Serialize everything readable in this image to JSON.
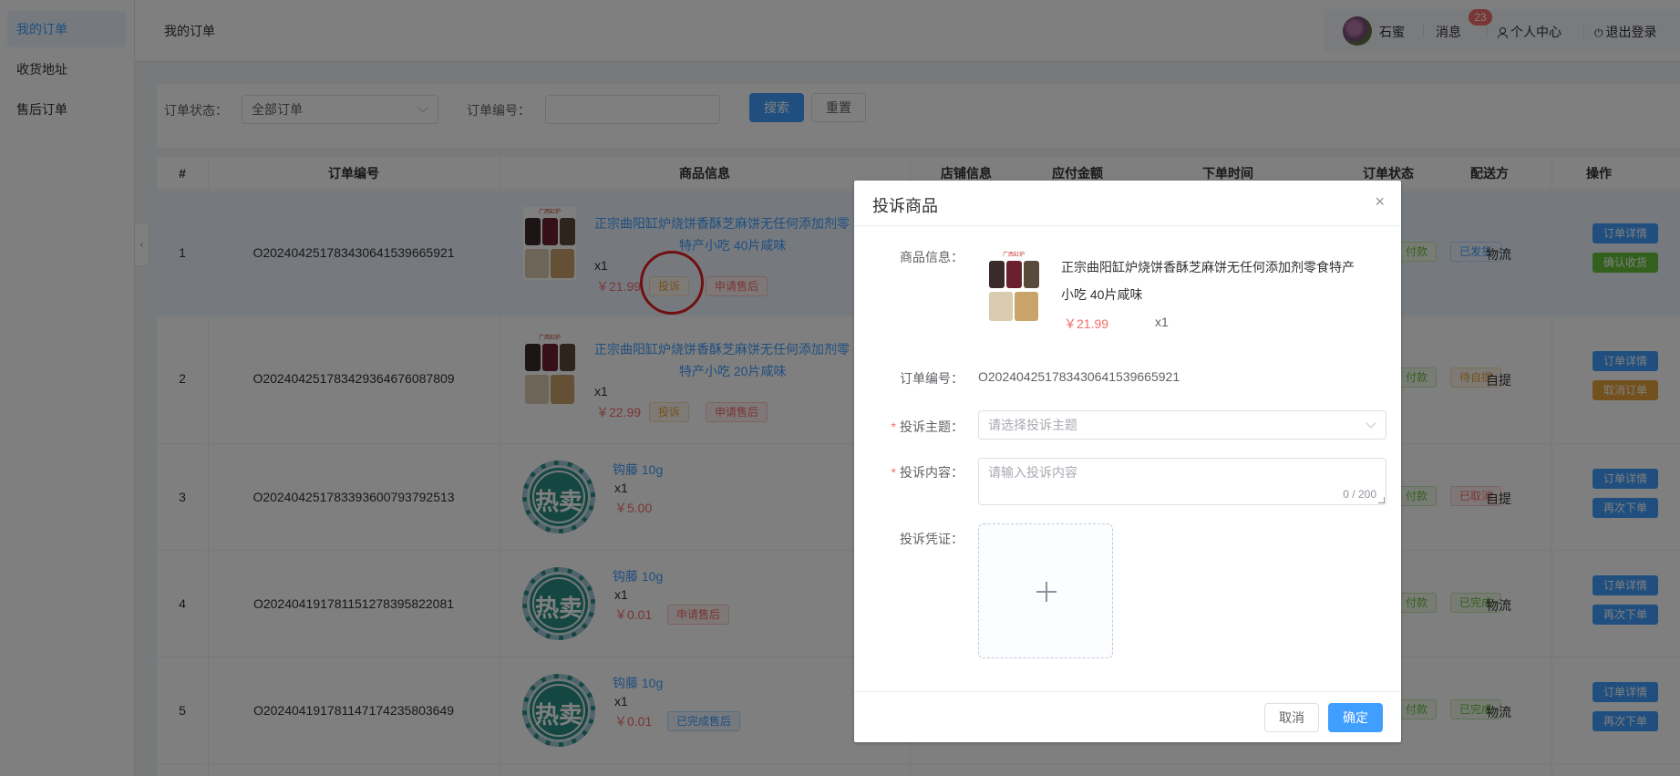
{
  "sidebar": {
    "items": [
      {
        "label": "我的订单"
      },
      {
        "label": "收货地址"
      },
      {
        "label": "售后订单"
      }
    ]
  },
  "header": {
    "title": "我的订单",
    "user_name": "石蜜",
    "messages_label": "消息",
    "messages_count": "23",
    "profile_label": "个人中心",
    "logout_label": "退出登录"
  },
  "filters": {
    "status_label": "订单状态：",
    "status_value": "全部订单",
    "order_no_label": "订单编号：",
    "search_button": "搜索",
    "reset_button": "重置"
  },
  "table": {
    "columns": [
      "#",
      "订单编号",
      "商品信息",
      "店铺信息",
      "应付金额",
      "下单时间",
      "订单状态",
      "配送方",
      "操作"
    ],
    "rows": [
      {
        "index": "1",
        "order_no": "O2024042517834306415396659​21",
        "product_name": "正宗曲阳缸炉烧饼香酥芝麻饼无任何添加剂零",
        "product_name_2": "特产小吃 40片咸味",
        "qty": "x1",
        "price": "￥21.99",
        "tags": [
          "投诉",
          "申请售后"
        ],
        "pay_tag": "付款",
        "status_tag": "已发货",
        "delivery": "物流",
        "actions": [
          "订单详情",
          "确认收货"
        ]
      },
      {
        "index": "2",
        "order_no": "O2024042517834293646760878​09",
        "product_name": "正宗曲阳缸炉烧饼香酥芝麻饼无任何添加剂零",
        "product_name_2": "特产小吃 20片咸味",
        "qty": "x1",
        "price": "￥22.99",
        "tags": [
          "投诉",
          "申请售后"
        ],
        "pay_tag": "付款",
        "status_tag": "待自提",
        "delivery": "自提",
        "actions": [
          "订单详情",
          "取消订单"
        ]
      },
      {
        "index": "3",
        "order_no": "O2024042517833936007937925​13",
        "product_name": "钩藤 10g",
        "qty": "x1",
        "price": "￥5.00",
        "pay_tag": "付款",
        "status_tag": "已取消",
        "delivery": "自提",
        "actions": [
          "订单详情",
          "再次下单"
        ]
      },
      {
        "index": "4",
        "order_no": "O2024041917811512783958220​81",
        "product_name": "钩藤 10g",
        "qty": "x1",
        "price": "￥0.01",
        "tags": [
          "申请售后"
        ],
        "pay_tag": "付款",
        "status_tag": "已完成",
        "delivery": "物流",
        "actions": [
          "订单详情",
          "再次下单"
        ]
      },
      {
        "index": "5",
        "order_no": "O2024041917811471742358036​49",
        "product_name": "钩藤 10g",
        "qty": "x1",
        "price": "￥0.01",
        "tags": [
          "已完成售后"
        ],
        "pay_tag": "付款",
        "status_tag": "已完成",
        "delivery": "物流",
        "actions": [
          "订单详情",
          "再次下单"
        ]
      }
    ],
    "hot_badge_text": "热卖",
    "thumb_caption": "广西缸炉"
  },
  "dialog": {
    "title": "投诉商品",
    "product_info_label": "商品信息：",
    "product_name": "正宗曲阳缸炉烧饼香酥芝麻饼无任何添加剂零食特产小吃 40片咸味",
    "price": "￥21.99",
    "qty": "x1",
    "order_no_label": "订单编号：",
    "order_no": "O202404251783430641539665921",
    "subject_label": "投诉主题：",
    "subject_placeholder": "请选择投诉主题",
    "content_label": "投诉内容：",
    "content_placeholder": "请输入投诉内容",
    "content_count": "0 / 200",
    "evidence_label": "投诉凭证：",
    "cancel_button": "取消",
    "confirm_button": "确定"
  },
  "colors": {
    "primary": "#409eff",
    "danger": "#f56c6c",
    "success": "#67c23a",
    "warning": "#e6a23c"
  }
}
